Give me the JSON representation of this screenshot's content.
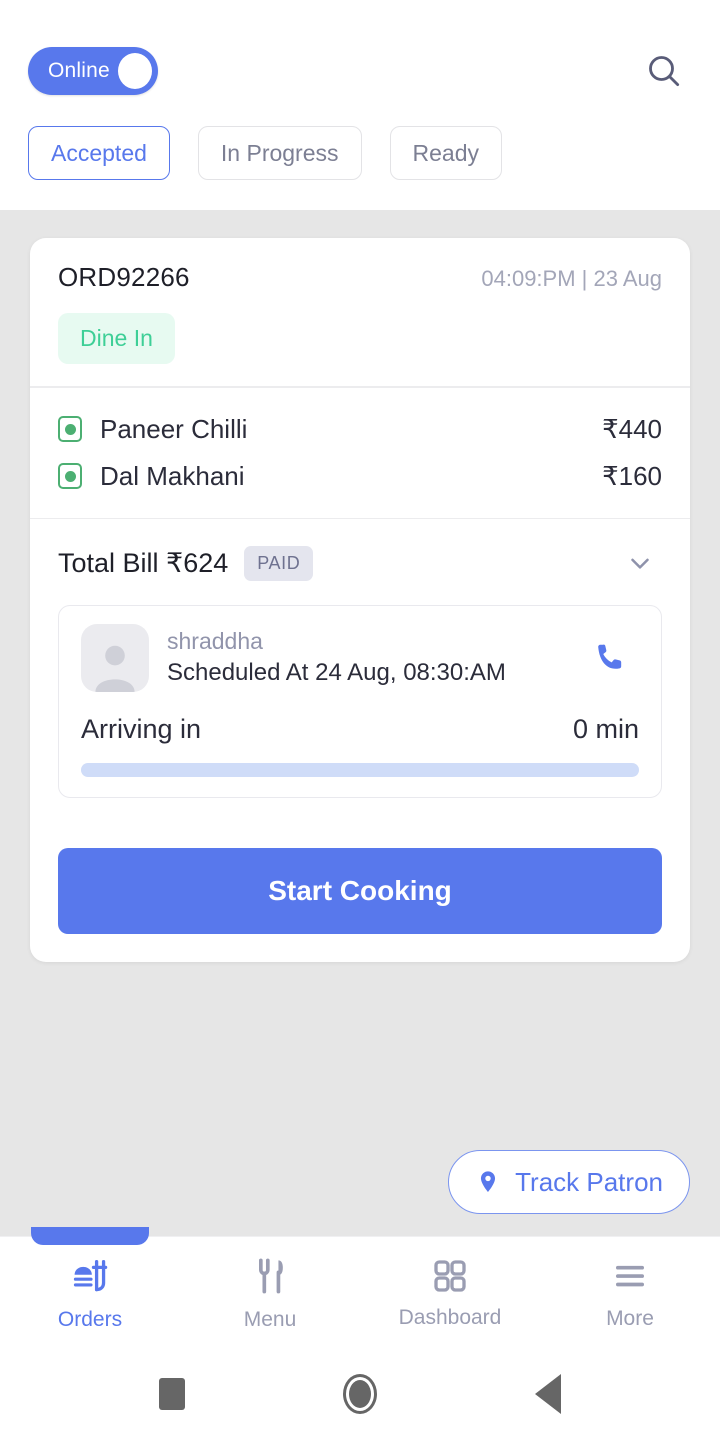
{
  "header": {
    "status_toggle": {
      "label": "Online",
      "on": true,
      "color": "#5878ec"
    },
    "search_icon": "search-icon"
  },
  "tabs": [
    {
      "label": "Accepted",
      "active": true
    },
    {
      "label": "In Progress",
      "active": false
    },
    {
      "label": "Ready",
      "active": false
    }
  ],
  "order": {
    "id": "ORD92266",
    "timestamp": "04:09:PM | 23 Aug",
    "type_badge": "Dine In",
    "type_badge_color": "#3ecf97",
    "items": [
      {
        "name": "Paneer Chilli",
        "price": "₹440",
        "diet": "veg"
      },
      {
        "name": "Dal Makhani",
        "price": "₹160",
        "diet": "veg"
      }
    ],
    "total_label": "Total Bill ₹624",
    "payment_badge": "PAID",
    "expand_icon": "chevron-down-icon",
    "patron": {
      "name": "shraddha",
      "scheduled": "Scheduled At 24 Aug, 08:30:AM",
      "call_icon": "phone-icon",
      "arriving_label": "Arriving in",
      "arriving_value": "0 min",
      "progress_percent": 0
    },
    "action_button": "Start Cooking"
  },
  "track_fab": {
    "label": "Track Patron",
    "icon": "location-pin-icon"
  },
  "bottom_nav": [
    {
      "label": "Orders",
      "icon": "orders-icon",
      "active": true
    },
    {
      "label": "Menu",
      "icon": "cutlery-icon",
      "active": false
    },
    {
      "label": "Dashboard",
      "icon": "grid-icon",
      "active": false
    },
    {
      "label": "More",
      "icon": "hamburger-icon",
      "active": false
    }
  ],
  "system_nav": [
    {
      "name": "recents-button"
    },
    {
      "name": "home-button"
    },
    {
      "name": "back-button"
    }
  ]
}
